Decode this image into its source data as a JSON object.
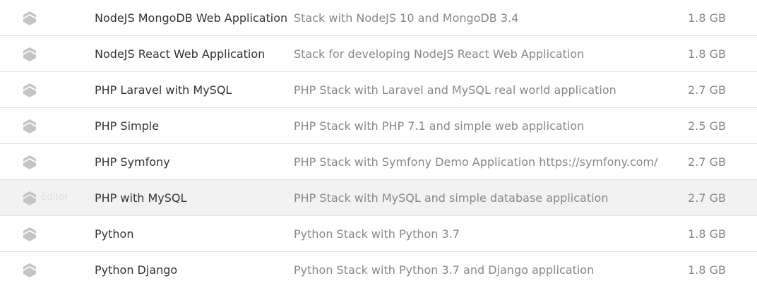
{
  "stacks": [
    {
      "name": "NodeJS MongoDB Web Application",
      "description": "Stack with NodeJS 10 and MongoDB 3.4",
      "size": "1.8 GB",
      "icon": "stack-icon"
    },
    {
      "name": "NodeJS React Web Application",
      "description": "Stack for developing NodeJS React Web Application",
      "size": "1.8 GB",
      "icon": "stack-icon"
    },
    {
      "name": "PHP Laravel with MySQL",
      "description": "PHP Stack with Laravel and MySQL real world application",
      "size": "2.7 GB",
      "icon": "stack-icon"
    },
    {
      "name": "PHP Simple",
      "description": "PHP Stack with PHP 7.1 and simple web application",
      "size": "2.5 GB",
      "icon": "stack-icon"
    },
    {
      "name": "PHP Symfony",
      "description": "PHP Stack with Symfony Demo Application https://symfony.com/",
      "size": "2.7 GB",
      "icon": "stack-icon"
    },
    {
      "name": "PHP with MySQL",
      "description": "PHP Stack with MySQL and simple database application",
      "size": "2.7 GB",
      "icon": "stack-icon",
      "hover_hint": "Editor"
    },
    {
      "name": "Python",
      "description": "Python Stack with Python 3.7",
      "size": "1.8 GB",
      "icon": "stack-icon"
    },
    {
      "name": "Python Django",
      "description": "Python Stack with Python 3.7 and Django application",
      "size": "1.8 GB",
      "icon": "stack-icon"
    }
  ],
  "colors": {
    "icon": "#c4c4c4",
    "divider": "#e4e4e4",
    "row_highlight": "#f2f2f2",
    "name_text": "#333333",
    "muted_text": "#888888"
  }
}
